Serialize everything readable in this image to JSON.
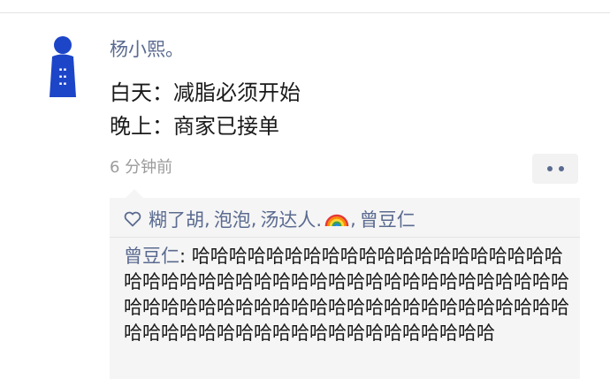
{
  "post": {
    "author": "杨小熙。",
    "lines": [
      "白天：减脂必须开始",
      "晚上：商家已接单"
    ],
    "time": "6 分钟前"
  },
  "likes": {
    "names": [
      "糊了胡",
      "泡泡",
      "汤达人."
    ],
    "last_name": "曾豆仁",
    "separator": ","
  },
  "comment": {
    "author": "曾豆仁",
    "colon": ": ",
    "text": "哈哈哈哈哈哈哈哈哈哈哈哈哈哈哈哈哈哈哈哈哈哈哈哈哈哈哈哈哈哈哈哈哈哈哈哈哈哈哈哈哈哈哈哈哈哈哈哈哈哈哈哈哈哈哈哈哈哈哈哈哈哈哈哈哈哈哈哈哈哈哈哈哈哈哈哈哈哈哈哈哈哈哈哈哈哈哈哈"
  },
  "colors": {
    "link": "#5a6a90",
    "avatar": "#1d45c8",
    "panel": "#f5f5f5"
  },
  "icons": [
    "avatar",
    "more-icon",
    "heart-icon",
    "rainbow-emoji"
  ]
}
